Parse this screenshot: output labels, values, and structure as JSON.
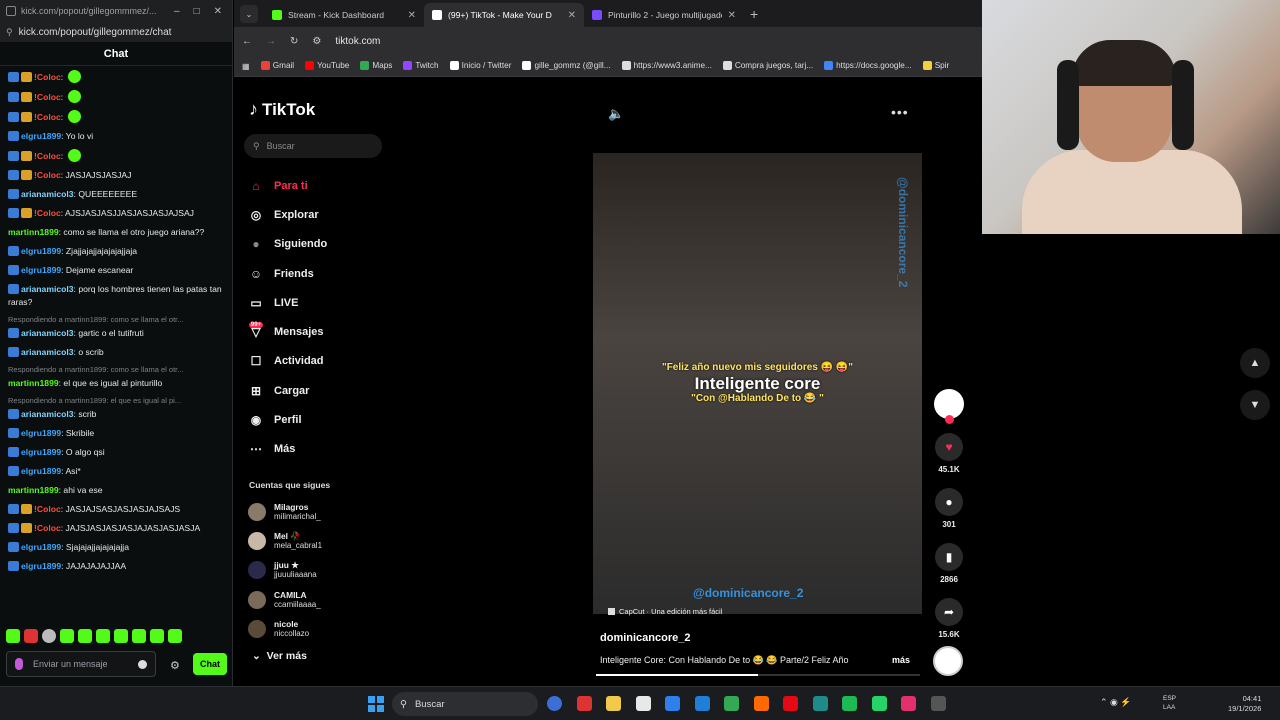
{
  "popup": {
    "title": "kick.com/popout/gillegommmez/...",
    "url": "kick.com/popout/gillegommez/chat",
    "chat_header": "Chat",
    "input_placeholder": "Enviar un mensaje",
    "chat_button": "Chat"
  },
  "chat": {
    "messages": [
      {
        "user": "!Coloc",
        "text": ":",
        "emote": true,
        "userColor": "#ff4b3d",
        "badges": [
          "v",
          "g"
        ]
      },
      {
        "user": "!Coloc",
        "text": ":",
        "emote": true,
        "userColor": "#ff4b3d",
        "badges": [
          "v",
          "g"
        ]
      },
      {
        "user": "!Coloc",
        "text": ":",
        "emote": true,
        "userColor": "#ff4b3d",
        "badges": [
          "v",
          "g"
        ]
      },
      {
        "user": "elgru1899",
        "text": ": Yo lo vi",
        "userColor": "#3da8ff",
        "badges": [
          "v"
        ]
      },
      {
        "user": "!Coloc",
        "text": ":",
        "emote": true,
        "userColor": "#ff4b3d",
        "badges": [
          "v",
          "g"
        ]
      },
      {
        "user": "!Coloc",
        "text": ": JASJAJSJASJAJ",
        "userColor": "#ff4b3d",
        "badges": [
          "v",
          "g"
        ]
      },
      {
        "user": "arianamicol3",
        "text": ": QUEEEEEEEE",
        "userColor": "#7fd6ff",
        "badges": [
          "v"
        ]
      },
      {
        "user": "!Coloc",
        "text": ": AJSJASJASJJASJASJASJAJSAJ",
        "userColor": "#ff4b3d",
        "badges": [
          "v",
          "g"
        ]
      },
      {
        "user": "martinn1899",
        "text": ": como se llama el otro juego ariana??",
        "userColor": "#53fc18",
        "badges": []
      },
      {
        "user": "elgru1899",
        "text": ": Zjajjajajjajajajajjaja",
        "userColor": "#3da8ff",
        "badges": [
          "v"
        ]
      },
      {
        "user": "elgru1899",
        "text": ": Dejame escanear",
        "userColor": "#3da8ff",
        "badges": [
          "v"
        ]
      },
      {
        "user": "arianamicol3",
        "text": ": porq los hombres tienen las patas tan raras?",
        "userColor": "#7fd6ff",
        "badges": [
          "v"
        ]
      },
      {
        "reply": "Respondiendo a martinn1899: como se llama el otr...",
        "user": "arianamicol3",
        "text": ": gartic o el tutifruti",
        "userColor": "#7fd6ff",
        "badges": [
          "v"
        ]
      },
      {
        "user": "arianamicol3",
        "text": ": o scrib",
        "userColor": "#7fd6ff",
        "badges": [
          "v"
        ]
      },
      {
        "reply": "Respondiendo a martinn1899: como se llama el otr...",
        "user": "martinn1899",
        "text": ": el que es igual al pinturillo",
        "userColor": "#53fc18",
        "badges": []
      },
      {
        "reply": "Respondiendo a martinn1899: el que es igual al pi...",
        "user": "arianamicol3",
        "text": ": scrib",
        "userColor": "#7fd6ff",
        "badges": [
          "v"
        ]
      },
      {
        "user": "elgru1899",
        "text": ": Skribile",
        "userColor": "#3da8ff",
        "badges": [
          "v"
        ]
      },
      {
        "user": "elgru1899",
        "text": ": O algo qsi",
        "userColor": "#3da8ff",
        "badges": [
          "v"
        ]
      },
      {
        "user": "elgru1899",
        "text": ": Asi*",
        "userColor": "#3da8ff",
        "badges": [
          "v"
        ]
      },
      {
        "user": "martinn1899",
        "text": ": ahi va ese",
        "userColor": "#53fc18",
        "badges": []
      },
      {
        "user": "!Coloc",
        "text": ": JASJAJSASJASJASJAJSAJS",
        "userColor": "#ff4b3d",
        "badges": [
          "v",
          "g"
        ]
      },
      {
        "user": "!Coloc",
        "text": ": JAJSJASJASJASJAJASJASJASJA",
        "userColor": "#ff4b3d",
        "badges": [
          "v",
          "g"
        ]
      },
      {
        "user": "elgru1899",
        "text": ": Sjajajajjajajajajja",
        "userColor": "#3da8ff",
        "badges": [
          "v"
        ]
      },
      {
        "user": "elgru1899",
        "text": ": JAJAJAJAJJAA",
        "userColor": "#3da8ff",
        "badges": [
          "v"
        ]
      }
    ]
  },
  "browser": {
    "tabs": [
      {
        "label": "Stream - Kick Dashboard",
        "favColor": "#53fc18"
      },
      {
        "label": "(99+) TikTok - Make Your D",
        "favColor": "#ffffff"
      },
      {
        "label": "Pinturillo 2 - Juego multijugado",
        "favColor": "#7a4cff"
      }
    ],
    "address": "tiktok.com",
    "bookmarks": [
      "Gmail",
      "YouTube",
      "Maps",
      "Twitch",
      "Inicio / Twitter",
      "gille_gommz (@gill...",
      "https://www3.anime...",
      "Compra juegos, tarj...",
      "https://docs.google...",
      "Spir"
    ]
  },
  "tiktok": {
    "brand": "TikTok",
    "search_placeholder": "Buscar",
    "nav": [
      {
        "label": "Para ti",
        "icon": "home-icon",
        "glyph": "⌂"
      },
      {
        "label": "Explorar",
        "icon": "compass-icon",
        "glyph": "◎"
      },
      {
        "label": "Siguiendo",
        "icon": "following-icon",
        "glyph": "●"
      },
      {
        "label": "Friends",
        "icon": "friends-icon",
        "glyph": "☺"
      },
      {
        "label": "LIVE",
        "icon": "live-icon",
        "glyph": "▭"
      },
      {
        "label": "Mensajes",
        "icon": "messages-icon",
        "glyph": "▽",
        "badge": "99+"
      },
      {
        "label": "Actividad",
        "icon": "activity-icon",
        "glyph": "☐"
      },
      {
        "label": "Cargar",
        "icon": "upload-icon",
        "glyph": "⊞"
      },
      {
        "label": "Perfil",
        "icon": "profile-icon",
        "glyph": "◉"
      },
      {
        "label": "Más",
        "icon": "more-icon",
        "glyph": "⋯"
      }
    ],
    "follows_title": "Cuentas que sigues",
    "follows": [
      {
        "name": "Milagros",
        "handle": "milimarichal_"
      },
      {
        "name": "Mel 🥀",
        "handle": "mela_cabral1"
      },
      {
        "name": "jjuu ★",
        "handle": "jjuuuliaaana"
      },
      {
        "name": "CAMILA",
        "handle": "ccamiilaaaa_"
      },
      {
        "name": "nicole",
        "handle": "niccollazo"
      }
    ],
    "ver_mas": "Ver más",
    "video": {
      "caption_line1": "\"Feliz año nuevo mis seguidores 😝 😝\"",
      "caption_line2": "Inteligente core",
      "caption_line3": "\"Con @Hablando De to 😂 \"",
      "watermark": "@dominicancore_2",
      "capcut": "CapCut · Una edición más fácil",
      "author": "dominicancore_2",
      "description": "Inteligente Core: Con Hablando De to 😂 😂 Parte/2 Feliz Año",
      "more": "más",
      "progress": 0.5
    },
    "actions": {
      "likes": "45.1K",
      "comments": "301",
      "saves": "2866",
      "shares": "15.6K"
    }
  },
  "taskbar": {
    "search": "Buscar",
    "lang_1": "ESP",
    "lang_2": "LAA",
    "time": "04:41",
    "date": "19/1/2026"
  }
}
